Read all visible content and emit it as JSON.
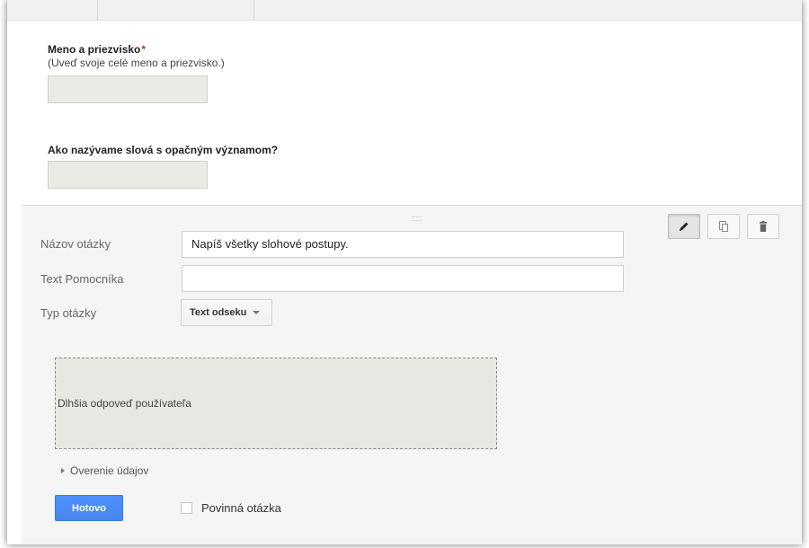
{
  "questions": [
    {
      "title": "Meno a priezvisko",
      "required_mark": "*",
      "help": "(Uveď svoje celé meno a priezvisko.)"
    },
    {
      "title": "Ako nazývame slová s opačným významom?"
    }
  ],
  "editor": {
    "drag_handle": ":::::",
    "toolbar": {
      "edit_icon": "pencil-icon",
      "duplicate_icon": "duplicate-icon",
      "delete_icon": "trash-icon"
    },
    "title_label": "Názov otázky",
    "title_value": "Napíš všetky slohové postupy.",
    "help_label": "Text Pomocníka",
    "help_value": "",
    "type_label": "Typ otázky",
    "type_value": "Text odseku",
    "preview_text": "Dlhšia odpoveď používateľa",
    "validation_label": "Overenie údajov",
    "done_label": "Hotovo",
    "required_label": "Povinná otázka",
    "required_checked": false
  },
  "colors": {
    "accent_blue": "#4d90fe",
    "required_red": "#c53929",
    "answer_box": "#ebebe6",
    "panel_bg": "#f5f5f5"
  }
}
